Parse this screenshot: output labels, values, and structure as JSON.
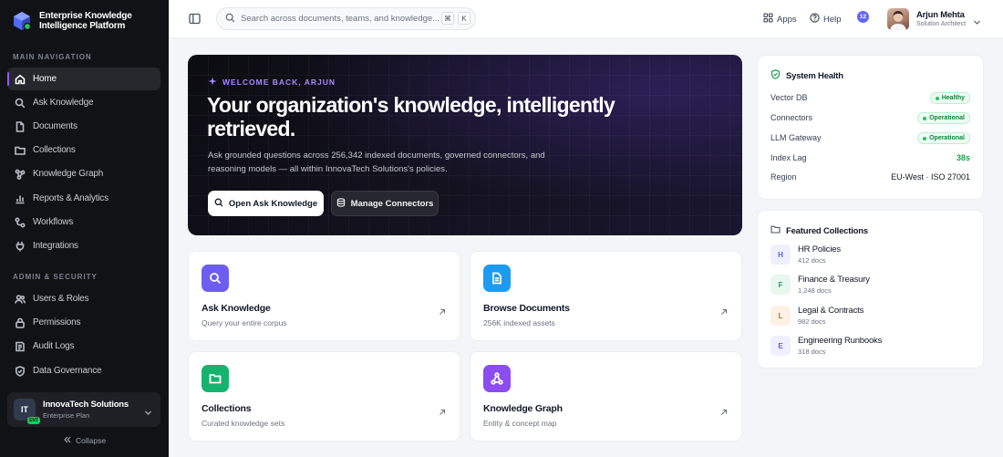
{
  "brand": {
    "title": "Enterprise Knowledge Intelligence Platform"
  },
  "sidebar": {
    "main_label": "MAIN NAVIGATION",
    "main_items": [
      {
        "label": "Home",
        "icon": "home-icon",
        "active": true
      },
      {
        "label": "Ask Knowledge",
        "icon": "search-icon"
      },
      {
        "label": "Documents",
        "icon": "document-icon"
      },
      {
        "label": "Collections",
        "icon": "folder-icon"
      },
      {
        "label": "Knowledge Graph",
        "icon": "graph-icon"
      },
      {
        "label": "Reports & Analytics",
        "icon": "bar-chart-icon"
      },
      {
        "label": "Workflows",
        "icon": "workflow-icon"
      },
      {
        "label": "Integrations",
        "icon": "plug-icon"
      }
    ],
    "admin_label": "ADMIN & SECURITY",
    "admin_items": [
      {
        "label": "Users & Roles",
        "icon": "users-icon"
      },
      {
        "label": "Permissions",
        "icon": "lock-icon"
      },
      {
        "label": "Audit Logs",
        "icon": "audit-icon"
      },
      {
        "label": "Data Governance",
        "icon": "shield-icon"
      }
    ],
    "org": {
      "initials": "IT",
      "badge": "ENT",
      "name": "InnovaTech Solutions",
      "plan": "Enterprise Plan"
    },
    "collapse_label": "Collapse"
  },
  "topbar": {
    "search_placeholder": "Search across documents, teams, and knowledge...",
    "kbd_cmd": "⌘",
    "kbd_key": "K",
    "apps_label": "Apps",
    "help_label": "Help",
    "notification_count": "12",
    "user_name": "Arjun Mehta",
    "user_role": "Solution Architect"
  },
  "hero": {
    "kicker": "WELCOME BACK, ARJUN",
    "title": "Your organization's knowledge, intelligently retrieved.",
    "subtitle": "Ask grounded questions across 256,342 indexed documents, governed connectors, and reasoning models — all within InnovaTech Solutions's policies.",
    "primary_button": "Open Ask Knowledge",
    "secondary_button": "Manage Connectors"
  },
  "cards": [
    {
      "title": "Ask Knowledge",
      "subtitle": "Query your entire corpus",
      "icon": "search-icon",
      "color": "#6d5df0"
    },
    {
      "title": "Browse Documents",
      "subtitle": "256K indexed assets",
      "icon": "document-icon",
      "color": "#1d9bf0"
    },
    {
      "title": "Collections",
      "subtitle": "Curated knowledge sets",
      "icon": "folder-icon",
      "color": "#16b36e"
    },
    {
      "title": "Knowledge Graph",
      "subtitle": "Entity & concept map",
      "icon": "graph-icon",
      "color": "#8b4cf0"
    }
  ],
  "system_health": {
    "title": "System Health",
    "rows": [
      {
        "label": "Vector DB",
        "value": "Healthy",
        "kind": "pill"
      },
      {
        "label": "Connectors",
        "value": "Operational",
        "kind": "pill"
      },
      {
        "label": "LLM Gateway",
        "value": "Operational",
        "kind": "pill"
      },
      {
        "label": "Index Lag",
        "value": "38s",
        "kind": "green"
      },
      {
        "label": "Region",
        "value": "EU-West · ISO 27001",
        "kind": "text"
      }
    ]
  },
  "featured": {
    "title": "Featured Collections",
    "items": [
      {
        "letter": "H",
        "name": "HR Policies",
        "docs": "412 docs",
        "bg": "#eef0ff",
        "fg": "#5b5fd6"
      },
      {
        "letter": "F",
        "name": "Finance & Treasury",
        "docs": "1,248 docs",
        "bg": "#e8f8ef",
        "fg": "#1c9a5a"
      },
      {
        "letter": "L",
        "name": "Legal & Contracts",
        "docs": "982 docs",
        "bg": "#fdf1e4",
        "fg": "#c2701c"
      },
      {
        "letter": "E",
        "name": "Engineering Runbooks",
        "docs": "318 docs",
        "bg": "#eef0ff",
        "fg": "#5b5fd6"
      }
    ]
  }
}
